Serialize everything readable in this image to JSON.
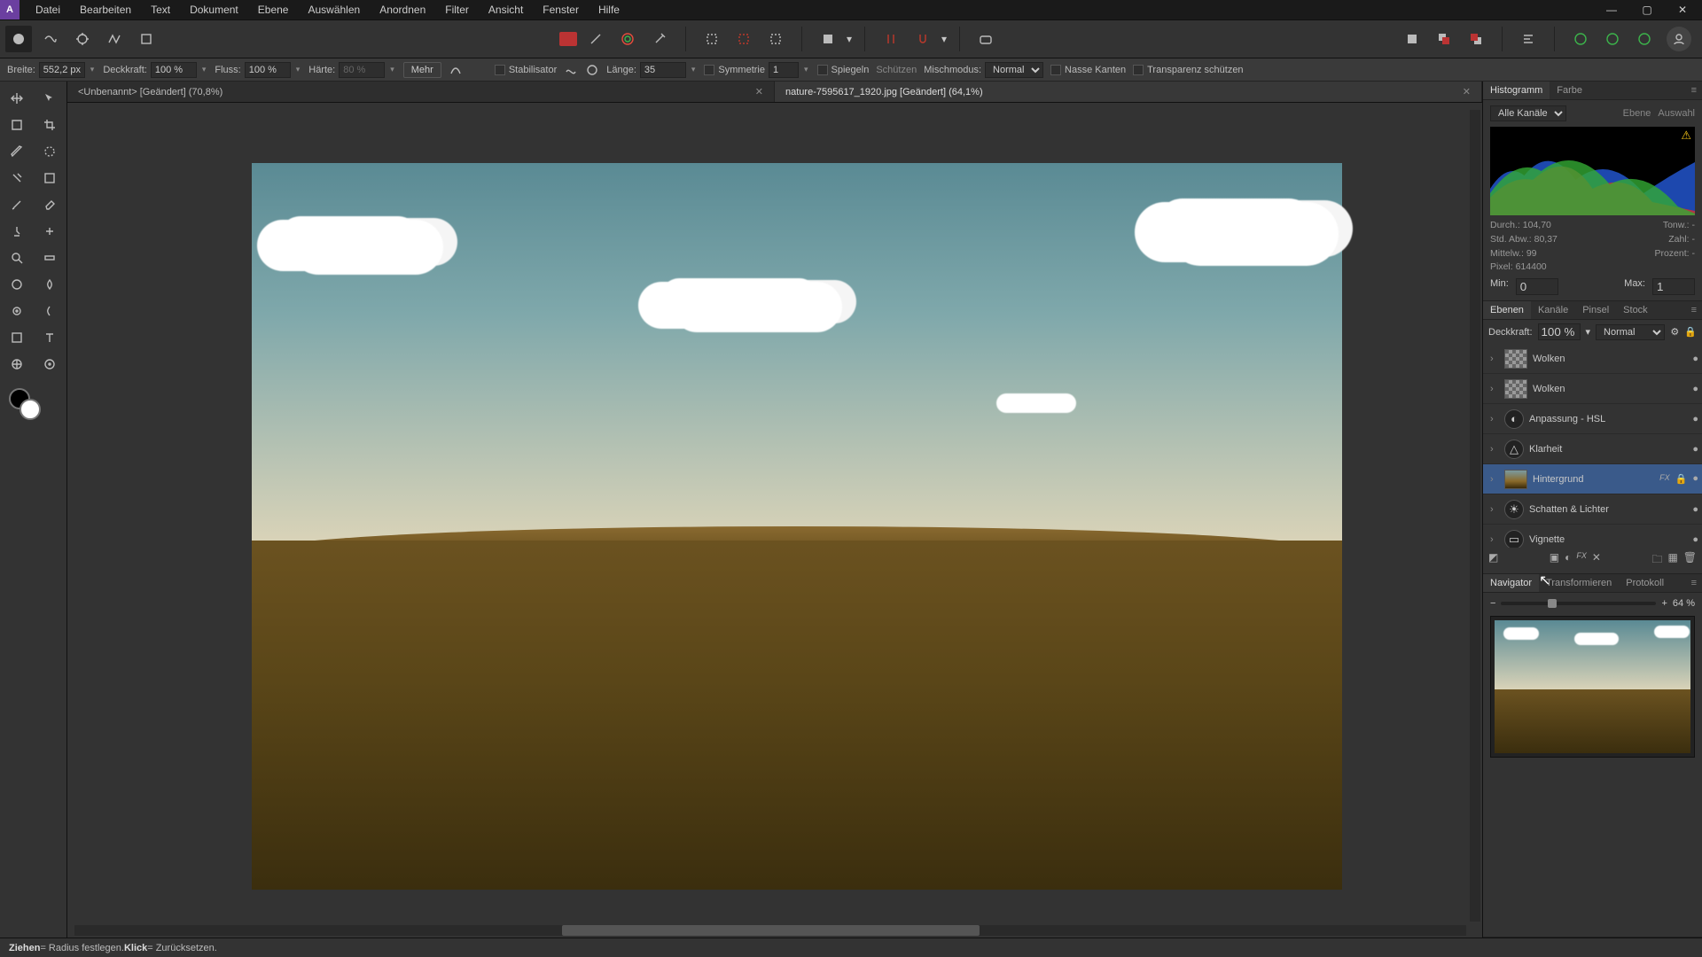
{
  "menu": [
    "Datei",
    "Bearbeiten",
    "Text",
    "Dokument",
    "Ebene",
    "Auswählen",
    "Anordnen",
    "Filter",
    "Ansicht",
    "Fenster",
    "Hilfe"
  ],
  "context": {
    "width_label": "Breite:",
    "width_value": "552,2 px",
    "opacity_label": "Deckkraft:",
    "opacity_value": "100 %",
    "flow_label": "Fluss:",
    "flow_value": "100 %",
    "hardness_label": "Härte:",
    "hardness_value": "80 %",
    "more": "Mehr",
    "stabilizer": "Stabilisator",
    "length_label": "Länge:",
    "length_value": "35",
    "symmetry_label": "Symmetrie",
    "symmetry_value": "1",
    "mirror": "Spiegeln",
    "protect": "Schützen",
    "blend_label": "Mischmodus:",
    "blend_value": "Normal",
    "wet": "Nasse Kanten",
    "transp": "Transparenz schützen"
  },
  "tabs": [
    {
      "title": "<Unbenannt> [Geändert] (70,8%)",
      "active": false
    },
    {
      "title": "nature-7595617_1920.jpg [Geändert] (64,1%)",
      "active": true
    }
  ],
  "right": {
    "histo_tabs": [
      "Histogramm",
      "Farbe"
    ],
    "channel": "Alle Kanäle",
    "rlinks": [
      "Ebene",
      "Auswahl"
    ],
    "stats": {
      "durch": "Durch.: 104,70",
      "std": "Std. Abw.: 80,37",
      "mittel": "Mittelw.: 99",
      "pixel": "Pixel: 614400",
      "tonw": "Tonw.: -",
      "prozent": "Prozent: -",
      "zahl": "Zahl: -"
    },
    "min_label": "Min:",
    "min_val": "0",
    "max_label": "Max:",
    "max_val": "1",
    "layer_tabs": [
      "Ebenen",
      "Kanäle",
      "Pinsel",
      "Stock"
    ],
    "layer_opacity_label": "Deckkraft:",
    "layer_opacity_value": "100 %",
    "layer_blend": "Normal",
    "layers": [
      {
        "name": "Wolken",
        "type": "checker"
      },
      {
        "name": "Wolken",
        "type": "checker"
      },
      {
        "name": "Anpassung - HSL",
        "type": "adj",
        "glyph": "◐"
      },
      {
        "name": "Klarheit",
        "type": "adj",
        "glyph": "△"
      },
      {
        "name": "Hintergrund",
        "type": "gradient",
        "selected": true,
        "fx": true,
        "lock": true
      },
      {
        "name": "Schatten & Lichter",
        "type": "adj",
        "glyph": "☀"
      },
      {
        "name": "Vignette",
        "type": "adj",
        "glyph": "▭"
      }
    ],
    "nav_tabs": [
      "Navigator",
      "Transformieren",
      "Protokoll"
    ],
    "zoom": "64 %"
  },
  "status": {
    "a": "Ziehen",
    "a2": " = Radius festlegen. ",
    "b": "Klick",
    "b2": " = Zurücksetzen."
  },
  "fx_label": "FX"
}
